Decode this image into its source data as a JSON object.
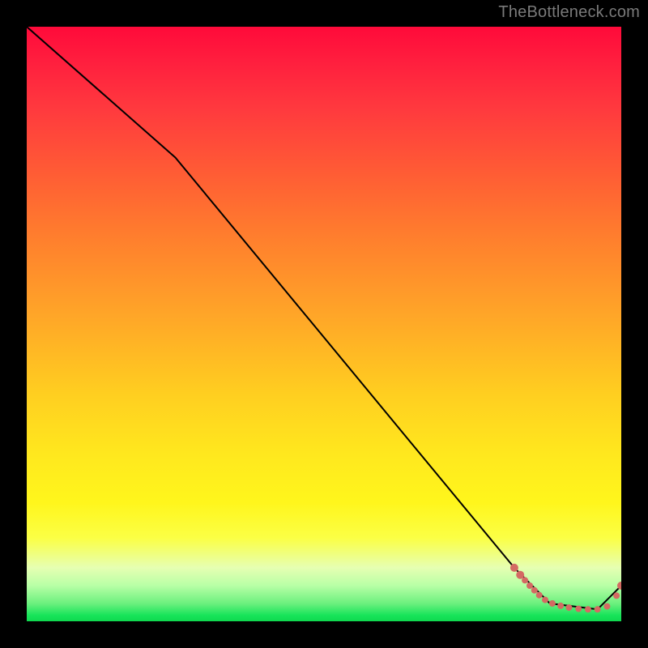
{
  "watermark": "TheBottleneck.com",
  "chart_data": {
    "type": "line",
    "title": "",
    "xlabel": "",
    "ylabel": "",
    "xlim": [
      0,
      100
    ],
    "ylim": [
      0,
      100
    ],
    "grid": false,
    "series": [
      {
        "name": "curve",
        "color": "#000000",
        "points": [
          {
            "x": 0,
            "y": 100
          },
          {
            "x": 25,
            "y": 78
          },
          {
            "x": 82,
            "y": 9
          },
          {
            "x": 88,
            "y": 3
          },
          {
            "x": 96,
            "y": 2
          },
          {
            "x": 100,
            "y": 6
          }
        ]
      }
    ],
    "markers": {
      "name": "dotted-tail",
      "color": "#d46a63",
      "points": [
        {
          "x": 82.0,
          "y": 9.0,
          "r": 5
        },
        {
          "x": 83.0,
          "y": 7.8,
          "r": 5
        },
        {
          "x": 83.8,
          "y": 6.9,
          "r": 4
        },
        {
          "x": 84.6,
          "y": 6.0,
          "r": 4
        },
        {
          "x": 85.4,
          "y": 5.2,
          "r": 4
        },
        {
          "x": 86.2,
          "y": 4.4,
          "r": 4
        },
        {
          "x": 87.2,
          "y": 3.6,
          "r": 4
        },
        {
          "x": 88.4,
          "y": 3.0,
          "r": 4
        },
        {
          "x": 89.8,
          "y": 2.6,
          "r": 4
        },
        {
          "x": 91.2,
          "y": 2.3,
          "r": 4
        },
        {
          "x": 92.8,
          "y": 2.1,
          "r": 4
        },
        {
          "x": 94.4,
          "y": 2.0,
          "r": 4
        },
        {
          "x": 96.0,
          "y": 2.0,
          "r": 4
        },
        {
          "x": 97.6,
          "y": 2.5,
          "r": 4
        },
        {
          "x": 99.2,
          "y": 4.3,
          "r": 4
        },
        {
          "x": 100.0,
          "y": 6.0,
          "r": 5
        }
      ]
    },
    "gradient_stops": [
      {
        "pos": 0.0,
        "color": "#ff0a3a"
      },
      {
        "pos": 0.24,
        "color": "#ff5a35"
      },
      {
        "pos": 0.48,
        "color": "#ffa428"
      },
      {
        "pos": 0.72,
        "color": "#ffe81e"
      },
      {
        "pos": 0.91,
        "color": "#e6ffb2"
      },
      {
        "pos": 1.0,
        "color": "#0fd94f"
      }
    ]
  }
}
